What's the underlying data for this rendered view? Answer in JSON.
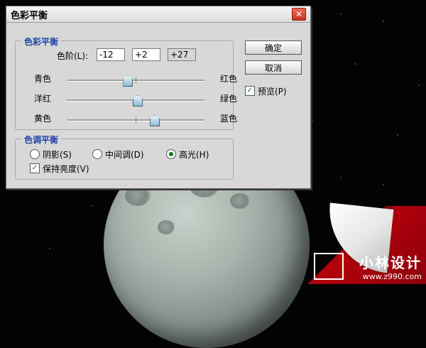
{
  "dialog": {
    "title": "色彩平衡",
    "close_label": "✕",
    "balance_group_label": "色彩平衡",
    "levels_label": "色阶(L):",
    "levels_values": [
      "-12",
      "+2",
      "+27"
    ],
    "sliders": [
      {
        "left": "青色",
        "right": "红色",
        "value": -12
      },
      {
        "left": "洋红",
        "right": "绿色",
        "value": 2
      },
      {
        "left": "黄色",
        "right": "蓝色",
        "value": 27
      }
    ],
    "buttons": {
      "ok": "确定",
      "cancel": "取消"
    },
    "preview_label": "预览(P)",
    "preview_checked": true,
    "tone_group_label": "色调平衡",
    "tone_options": [
      "阴影(S)",
      "中间调(D)",
      "高光(H)"
    ],
    "tone_selected": 2,
    "preserve_label": "保持亮度(V)",
    "preserve_checked": true
  },
  "watermark": {
    "title": "小林设计",
    "url": "www.z990.com"
  },
  "colors": {
    "legend_blue": "#1f44a6",
    "check_green": "#0b7b0b",
    "curl_red": "#b3000d"
  }
}
